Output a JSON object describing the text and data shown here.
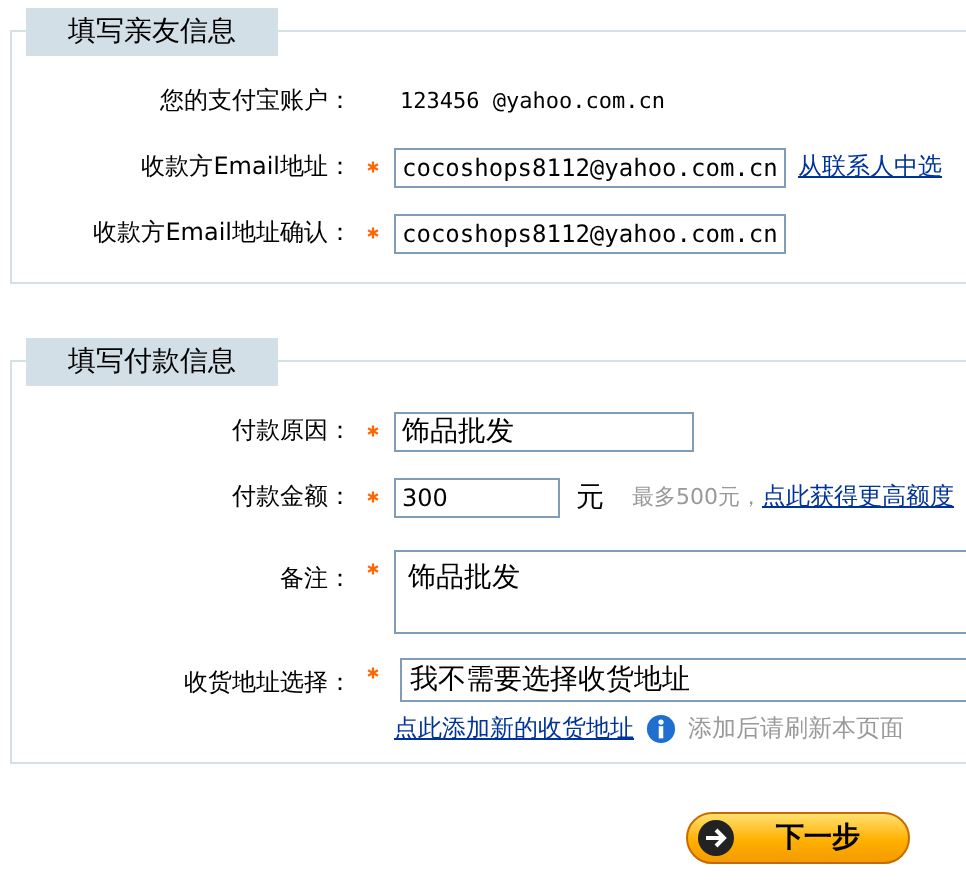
{
  "sections": [
    {
      "title": "填写亲友信息",
      "rows": [
        {
          "label": "您的支付宝账户：",
          "required": false,
          "kind": "text",
          "value": "123456 @yahoo.com.cn"
        },
        {
          "label": "收款方Email地址：",
          "required": true,
          "kind": "wide_input",
          "value": "cocoshops8112@yahoo.com.cn",
          "link": "从联系人中选"
        },
        {
          "label": "收款方Email地址确认：",
          "required": true,
          "kind": "wide_input",
          "value": "cocoshops8112@yahoo.com.cn"
        }
      ]
    },
    {
      "title": "填写付款信息",
      "rows": [
        {
          "label": "付款原因：",
          "required": true,
          "kind": "input",
          "value": "饰品批发"
        },
        {
          "label": "付款金额：",
          "required": true,
          "kind": "small_input",
          "value": "300",
          "unit": "元",
          "hint": "最多500元，",
          "link": "点此获得更高额度"
        },
        {
          "label": "备注：",
          "required": true,
          "kind": "textarea",
          "value": "饰品批发"
        },
        {
          "label": "收货地址选择：",
          "required": true,
          "kind": "select",
          "value": "我不需要选择收货地址",
          "below_link": "点此添加新的收货地址",
          "below_note": "添加后请刷新本页面"
        }
      ]
    }
  ],
  "button": "下一步"
}
